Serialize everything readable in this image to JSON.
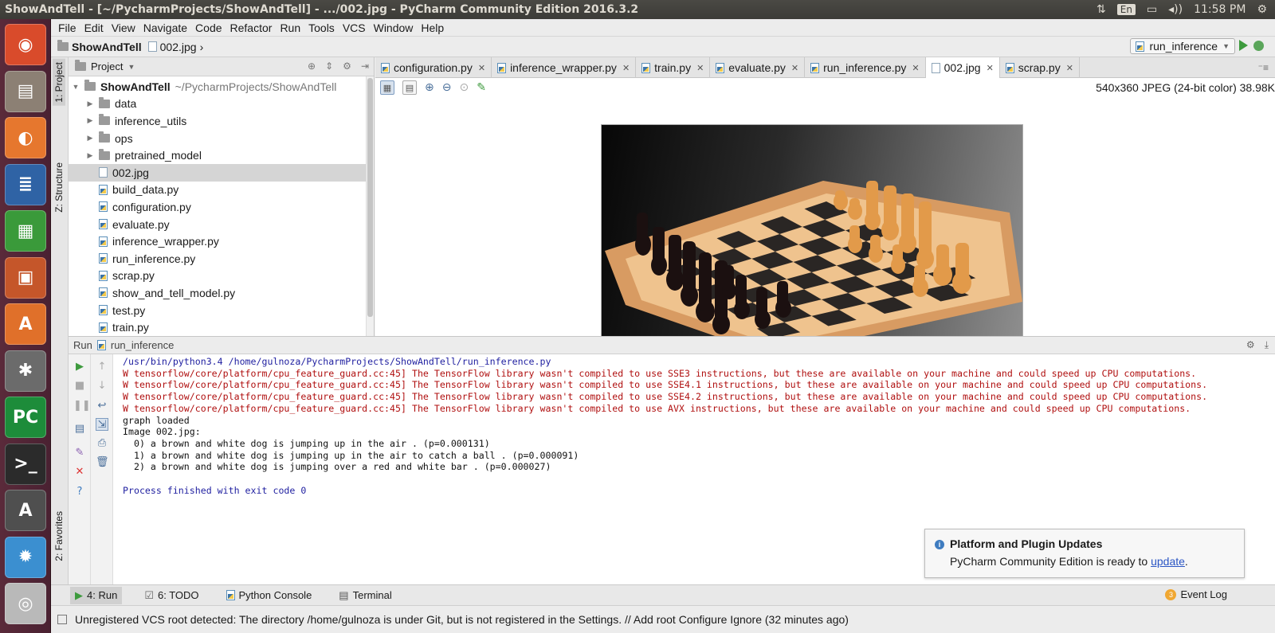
{
  "system": {
    "window_title": "ShowAndTell - [~/PycharmProjects/ShowAndTell] - .../002.jpg - PyCharm Community Edition 2016.3.2",
    "lang": "En",
    "clock": "11:58 PM"
  },
  "launcher": [
    {
      "name": "ubuntu-dash-icon",
      "glyph": "◉",
      "color": "#d94b2b"
    },
    {
      "name": "files-icon",
      "glyph": "▤",
      "color": "#8c8074"
    },
    {
      "name": "firefox-icon",
      "glyph": "◐",
      "color": "#e6772e"
    },
    {
      "name": "writer-icon",
      "glyph": "≣",
      "color": "#2f63a5"
    },
    {
      "name": "calc-icon",
      "glyph": "▦",
      "color": "#3a9a3a"
    },
    {
      "name": "impress-icon",
      "glyph": "▣",
      "color": "#c5562a"
    },
    {
      "name": "software-center-icon",
      "glyph": "A",
      "color": "#e0702a"
    },
    {
      "name": "settings-icon",
      "glyph": "✱",
      "color": "#6b6b6b"
    },
    {
      "name": "pycharm-icon",
      "glyph": "PC",
      "color": "#1d8c3a"
    },
    {
      "name": "terminal-icon",
      "glyph": ">_",
      "color": "#2b2b2b"
    },
    {
      "name": "updater-icon",
      "glyph": "A",
      "color": "#4f4f4f"
    },
    {
      "name": "display-icon",
      "glyph": "✹",
      "color": "#3b8fd0"
    },
    {
      "name": "dvd-icon",
      "glyph": "◎",
      "color": "#b9b9b9"
    }
  ],
  "menu": [
    "File",
    "Edit",
    "View",
    "Navigate",
    "Code",
    "Refactor",
    "Run",
    "Tools",
    "VCS",
    "Window",
    "Help"
  ],
  "breadcrumb": {
    "project": "ShowAndTell",
    "file": "002.jpg"
  },
  "run_config": "run_inference",
  "left_tabs": {
    "project": "1: Project",
    "structure": "Z: Structure",
    "favorites": "2: Favorites"
  },
  "project_panel": {
    "title": "Project",
    "root": {
      "name": "ShowAndTell",
      "path": "~/PycharmProjects/ShowAndTell"
    },
    "folders": [
      "data",
      "inference_utils",
      "ops",
      "pretrained_model"
    ],
    "files": [
      "002.jpg",
      "build_data.py",
      "configuration.py",
      "evaluate.py",
      "inference_wrapper.py",
      "run_inference.py",
      "scrap.py",
      "show_and_tell_model.py",
      "test.py",
      "train.py"
    ],
    "selected": "002.jpg"
  },
  "editor_tabs": [
    {
      "label": "configuration.py",
      "kind": "py"
    },
    {
      "label": "inference_wrapper.py",
      "kind": "py"
    },
    {
      "label": "train.py",
      "kind": "py"
    },
    {
      "label": "evaluate.py",
      "kind": "py"
    },
    {
      "label": "run_inference.py",
      "kind": "py"
    },
    {
      "label": "002.jpg",
      "kind": "img",
      "active": true
    },
    {
      "label": "scrap.py",
      "kind": "py"
    }
  ],
  "image_info": "540x360 JPEG (24-bit color) 38.98K",
  "run_panel": {
    "label": "Run",
    "config": "run_inference",
    "lines": [
      {
        "kind": "cmd",
        "text": "/usr/bin/python3.4 /home/gulnoza/PycharmProjects/ShowAndTell/run_inference.py"
      },
      {
        "kind": "err",
        "text": "W tensorflow/core/platform/cpu_feature_guard.cc:45] The TensorFlow library wasn't compiled to use SSE3 instructions, but these are available on your machine and could speed up CPU computations."
      },
      {
        "kind": "err",
        "text": "W tensorflow/core/platform/cpu_feature_guard.cc:45] The TensorFlow library wasn't compiled to use SSE4.1 instructions, but these are available on your machine and could speed up CPU computations."
      },
      {
        "kind": "err",
        "text": "W tensorflow/core/platform/cpu_feature_guard.cc:45] The TensorFlow library wasn't compiled to use SSE4.2 instructions, but these are available on your machine and could speed up CPU computations."
      },
      {
        "kind": "err",
        "text": "W tensorflow/core/platform/cpu_feature_guard.cc:45] The TensorFlow library wasn't compiled to use AVX instructions, but these are available on your machine and could speed up CPU computations."
      },
      {
        "kind": "out",
        "text": "graph loaded"
      },
      {
        "kind": "out",
        "text": "Image 002.jpg:"
      },
      {
        "kind": "out",
        "text": "  0) a brown and white dog is jumping up in the air . (p=0.000131)"
      },
      {
        "kind": "out",
        "text": "  1) a brown and white dog is jumping up in the air to catch a ball . (p=0.000091)"
      },
      {
        "kind": "out",
        "text": "  2) a brown and white dog is jumping over a red and white bar . (p=0.000027)"
      },
      {
        "kind": "out",
        "text": ""
      },
      {
        "kind": "fin",
        "text": "Process finished with exit code 0"
      }
    ]
  },
  "notification": {
    "title": "Platform and Plugin Updates",
    "body": "PyCharm Community Edition is ready to ",
    "link": "update",
    "suffix": "."
  },
  "bottom_tabs": {
    "run": "4: Run",
    "todo": "6: TODO",
    "console": "Python Console",
    "terminal": "Terminal",
    "event_log": "Event Log",
    "event_count": "3"
  },
  "status": "Unregistered VCS root detected: The directory /home/gulnoza is under Git, but is not registered in the Settings. // Add root  Configure  Ignore (32 minutes ago)"
}
